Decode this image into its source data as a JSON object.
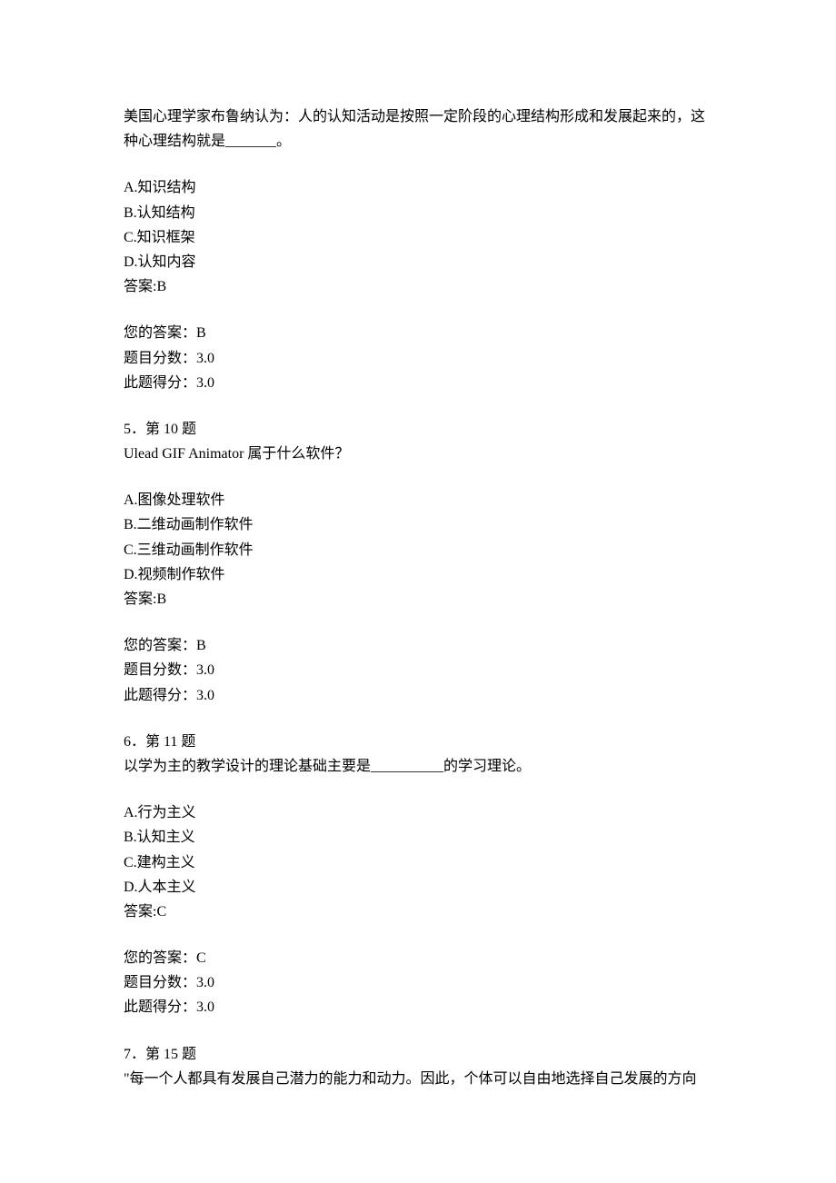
{
  "q4": {
    "stem": "美国心理学家布鲁纳认为：人的认知活动是按照一定阶段的心理结构形成和发展起来的，这种心理结构就是_______。",
    "optA": "A.知识结构",
    "optB": "B.认知结构",
    "optC": "C.知识框架",
    "optD": "D.认知内容",
    "answerKey": "答案:B",
    "yourAnswer": "您的答案：B",
    "scoreTotal": "题目分数：3.0",
    "scoreEarned": "此题得分：3.0"
  },
  "q5": {
    "header": "5．第 10 题",
    "stem": "Ulead GIF Animator 属于什么软件？",
    "optA": "A.图像处理软件",
    "optB": "B.二维动画制作软件",
    "optC": "C.三维动画制作软件",
    "optD": "D.视频制作软件",
    "answerKey": "答案:B",
    "yourAnswer": "您的答案：B",
    "scoreTotal": "题目分数：3.0",
    "scoreEarned": "此题得分：3.0"
  },
  "q6": {
    "header": "6．第 11 题",
    "stem": "以学为主的教学设计的理论基础主要是__________的学习理论。",
    "optA": "A.行为主义",
    "optB": "B.认知主义",
    "optC": "C.建构主义",
    "optD": "D.人本主义",
    "answerKey": "答案:C",
    "yourAnswer": "您的答案：C",
    "scoreTotal": "题目分数：3.0",
    "scoreEarned": "此题得分：3.0"
  },
  "q7": {
    "header": "7．第 15 题",
    "stem": "\"每一个人都具有发展自己潜力的能力和动力。因此，个体可以自由地选择自己发展的方向"
  }
}
